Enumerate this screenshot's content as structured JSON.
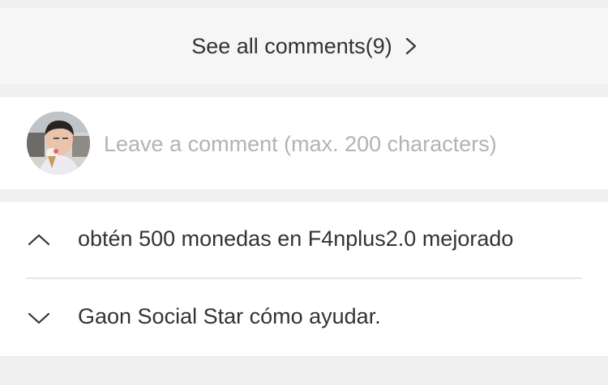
{
  "comments": {
    "see_all_label": "See all comments(9)",
    "input_placeholder": "Leave a comment (max. 200 characters)"
  },
  "post_nav": {
    "previous_title": "obtén 500 monedas en F4nplus2.0 mejorado",
    "next_title": "Gaon Social Star cómo ayudar."
  },
  "icons": {
    "see_all": "chevron-right-icon",
    "previous": "chevron-up-icon",
    "next": "chevron-down-icon"
  },
  "colors": {
    "page_bg": "#f0f0f0",
    "text": "#333333",
    "placeholder": "#b3b3b3",
    "divider": "#e5e5e5"
  }
}
